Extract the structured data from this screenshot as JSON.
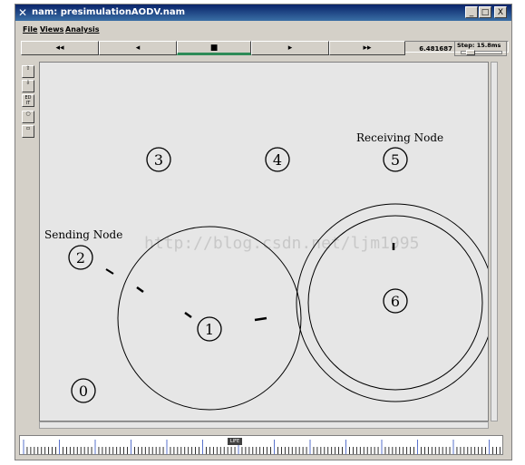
{
  "window": {
    "title": "nam: presimulationAODV.nam",
    "controls": {
      "minimize": "_",
      "maximize": "□",
      "close": "X"
    }
  },
  "menu": {
    "items": [
      "File",
      "Views",
      "Analysis"
    ],
    "file_label": "presimulationAODV.nam"
  },
  "playback": {
    "buttons": [
      "◂◂",
      "◂",
      "■",
      "▸",
      "▸▸"
    ],
    "active_button": "stop",
    "time": "6.481687",
    "step": "Step: 15.8ms"
  },
  "tools": [
    "zoom-in-icon",
    "zoom-out-icon",
    "edit-icon",
    "circle-icon",
    "square-icon"
  ],
  "tool_glyphs": [
    "⇧",
    "⇩",
    "ED\nIT",
    "○",
    "▫"
  ],
  "nodes": [
    {
      "id": "0"
    },
    {
      "id": "1"
    },
    {
      "id": "2"
    },
    {
      "id": "3"
    },
    {
      "id": "4"
    },
    {
      "id": "5"
    },
    {
      "id": "6"
    }
  ],
  "annotations": {
    "sending": "Sending Node",
    "receiving": "Receiving Node"
  },
  "watermark": "http://blog.csdn.net/ljm1995",
  "timeline": {
    "knob_label": "LIFE"
  },
  "colors": {
    "title_bar": "#0a246a",
    "canvas": "#e6e6e6",
    "active_button_accent": "#2e8b57"
  }
}
